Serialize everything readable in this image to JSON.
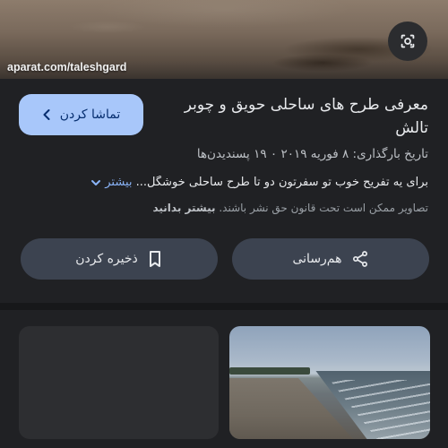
{
  "hero": {
    "watermark": "aparat.com/taleshgard",
    "lens_icon": "google-lens-icon"
  },
  "video": {
    "watch_label": "تماشا کردن",
    "watch_icon": "chevron-left-icon",
    "title": "معرفی طرح های ساحلی حویق و چوبر تالش",
    "meta": "تاریخ بارگذاری: ۸ فوریه ۲۰۱۹ ۰ ۱۹ پسندیدن‌ها",
    "description": "برای یه تفریح خوب تو سفرتون دو تا طرح ساحلی خوشگل...",
    "more_label": "بیشتر",
    "more_icon": "chevron-down-icon",
    "copyright": "تصاویر ممکن است تحت قانون حق نشر باشند.",
    "learn_more": "بیشتر بدانید"
  },
  "actions": {
    "share_label": "هم‌رسانی",
    "share_icon": "share-icon",
    "save_label": "ذخیره کردن",
    "save_icon": "bookmark-icon"
  },
  "colors": {
    "background": "#202124",
    "accent": "#a8c7fa",
    "link": "#8ab4f8",
    "pill": "#3c4350"
  }
}
